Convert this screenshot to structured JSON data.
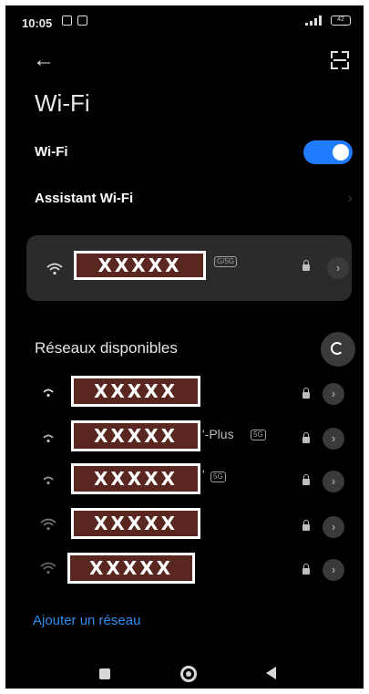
{
  "status": {
    "time": "10:05",
    "battery": "42"
  },
  "page": {
    "title": "Wi-Fi"
  },
  "wifi_toggle": {
    "label": "Wi-Fi",
    "on": true
  },
  "assistant": {
    "label": "Assistant Wi-Fi"
  },
  "connected": {
    "name_redacted": "XXXXX",
    "band_badge": "G/5G"
  },
  "available": {
    "label": "Réseaux disponibles",
    "networks": [
      {
        "name_redacted": "XXXXX",
        "suffix": "",
        "badge": ""
      },
      {
        "name_redacted": "XXXXX",
        "suffix": "'-Plus",
        "badge": "5G"
      },
      {
        "name_redacted": "XXXXX",
        "suffix": "'",
        "badge": "5G"
      },
      {
        "name_redacted": "XXXXX",
        "suffix": "",
        "badge": ""
      },
      {
        "name_redacted": "XXXXX",
        "suffix": "",
        "badge": ""
      }
    ]
  },
  "add_network": {
    "label": "Ajouter un réseau"
  },
  "colors": {
    "accent": "#1f7cff",
    "link": "#2e8cf0",
    "card": "#2b2b2b",
    "background": "#000000"
  },
  "icons": {
    "back": "arrow-left-icon",
    "scan": "scan-qr-icon",
    "wifi": "wifi-signal-icon",
    "lock": "lock-icon",
    "chevron": "chevron-right-icon",
    "refresh": "refresh-icon"
  }
}
